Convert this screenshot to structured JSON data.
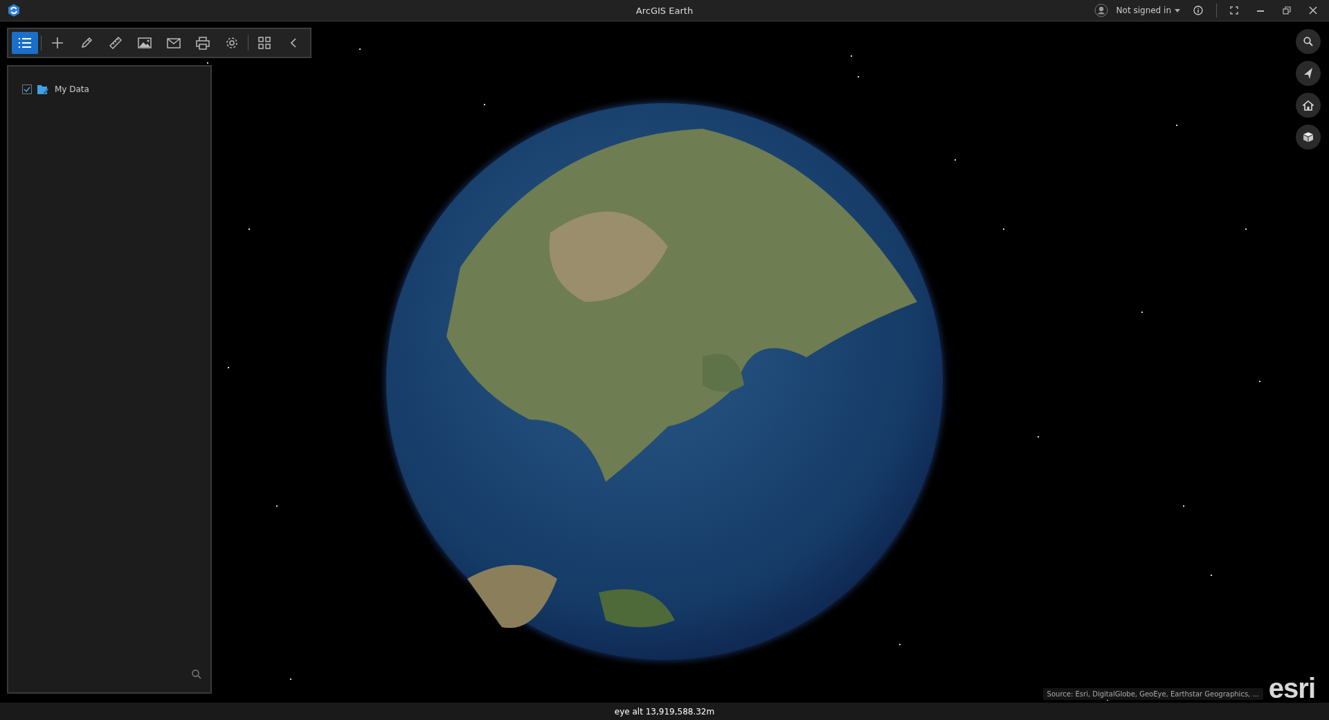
{
  "window": {
    "title": "ArcGIS Earth"
  },
  "account": {
    "label": "Not signed in"
  },
  "toolbar": {
    "tools": [
      {
        "kind": "layers",
        "selected": true
      },
      {
        "kind": "add",
        "selected": false
      },
      {
        "kind": "draw",
        "selected": false
      },
      {
        "kind": "measure",
        "selected": false
      },
      {
        "kind": "image",
        "selected": false
      },
      {
        "kind": "mail",
        "selected": false
      },
      {
        "kind": "print",
        "selected": false
      },
      {
        "kind": "settings",
        "selected": false
      },
      {
        "kind": "apps",
        "selected": false
      },
      {
        "kind": "collapse",
        "selected": false
      }
    ]
  },
  "layers": [
    {
      "name": "My Data",
      "checked": true
    }
  ],
  "attribution": "Source: Esri, DigitalGlobe, GeoEye, Earthstar Geographics, ...",
  "logo": "esri",
  "status_bar": {
    "text": "eye alt 13,919,588.32m"
  }
}
